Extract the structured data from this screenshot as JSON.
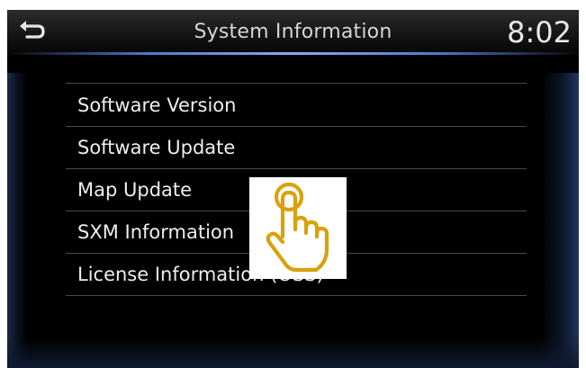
{
  "header": {
    "title": "System Information",
    "time": "8:02",
    "back_icon": "back-arrow-icon"
  },
  "menu": {
    "items": [
      {
        "label": "Software Version"
      },
      {
        "label": "Software Update"
      },
      {
        "label": "Map Update"
      },
      {
        "label": "SXM Information"
      },
      {
        "label": "License Information (OSS)"
      }
    ]
  },
  "overlay": {
    "icon": "tap-hand-icon",
    "color": "#d8a20c"
  },
  "colors": {
    "header_accent": "#6f95e6",
    "text": "#eeeeee",
    "divider": "#4a4a4a"
  }
}
